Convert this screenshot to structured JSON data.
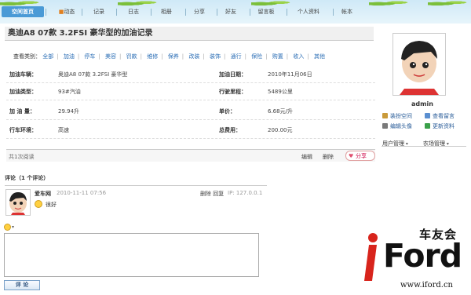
{
  "nav": {
    "items": [
      "空间首页",
      "动态",
      "记录",
      "日志",
      "相册",
      "分享",
      "好友",
      "留言板",
      "个人资料",
      "帐本"
    ],
    "active_index": 0
  },
  "page": {
    "title": "奥迪A8 07款 3.2FSI 豪华型的加油记录"
  },
  "categories": {
    "label": "查看类别：",
    "items": [
      "全部",
      "加油",
      "停车",
      "美容",
      "罚款",
      "维修",
      "保养",
      "改装",
      "装饰",
      "通行",
      "保险",
      "购置",
      "收入",
      "其他"
    ]
  },
  "details": {
    "vehicle_label": "加油车辆：",
    "vehicle": "奥迪A8 07款 3.2FSI 豪华型",
    "date_label": "加油日期：",
    "date": "2010年11月06日",
    "type_label": "加油类型：",
    "type": "93#汽油",
    "mileage_label": "行驶里程：",
    "mileage": "5489公里",
    "amount_label": "加 油 量：",
    "amount": "29.94升",
    "price_label": "单价：",
    "price": "6.68元/升",
    "env_label": "行车环境：",
    "env": "高速",
    "total_label": "总费用：",
    "total": "200.00元"
  },
  "footer": {
    "reads": "共1次阅读",
    "edit": "编辑",
    "delete": "删除",
    "share": "分享"
  },
  "comments": {
    "title": "评论（1 个评论）",
    "items": [
      {
        "author": "爱车网",
        "time": "2010-11-11 07:56",
        "actions": "删除 回复",
        "ip": "IP: 127.0.0.1",
        "text": "很好"
      }
    ],
    "submit": "评 论"
  },
  "sidebar": {
    "username": "admin",
    "links": [
      "装扮空间",
      "查看留言",
      "编辑头像",
      "更新资料"
    ],
    "menus": [
      "用户管理",
      "农场管理"
    ]
  },
  "watermark": {
    "brand_cn": "车友会",
    "brand": "Ford",
    "url": "www.iford.cn"
  },
  "colors": {
    "nav_active": "#4a9ad6",
    "link": "#2a6db5",
    "logo_red": "#d8241c"
  }
}
